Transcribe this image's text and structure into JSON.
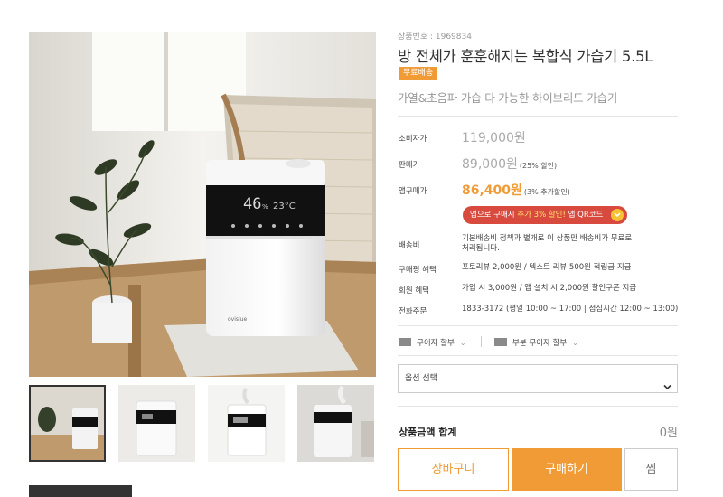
{
  "product": {
    "code": "상품번호 : 1969834",
    "title": "방 전체가 훈훈해지는 복합식 가습기 5.5L",
    "badge": "무료배송",
    "subtitle": "가열&초음파 가습 다 가능한 하이브리드 가습기",
    "device_display": {
      "humidity": "46",
      "unit": "%",
      "temp": "23°C",
      "brand": "ovislue"
    }
  },
  "prices": {
    "retail": {
      "label": "소비자가",
      "value": "119,000원"
    },
    "sale": {
      "label": "판매가",
      "value": "89,000원",
      "note": "(25% 할인)"
    },
    "app": {
      "label": "앱구매가",
      "value": "86,400원",
      "note": "(3% 추가할인)"
    }
  },
  "app_button": {
    "pre": "앱으로 구매시 ",
    "highlight": "추가 3% 할인!",
    "post": " 앱 QR코드"
  },
  "details": {
    "shipping": {
      "label": "배송비",
      "line1": "기본배송비 정책과 별개로 이 상품만 배송비가 무료로",
      "line2": "처리됩니다."
    },
    "review_benefit": {
      "label": "구매평 혜택",
      "text": "포토리뷰 2,000원 / 텍스트 리뷰 500원 적립금 지급"
    },
    "member_benefit": {
      "label": "회원 혜택",
      "text": "가입 시 3,000원 / 앱 설치 시 2,000원 할인쿠폰 지급"
    },
    "phone_order": {
      "label": "전화주문",
      "text": "1833-3172 (평일 10:00 ~ 17:00 | 점심시간 12:00 ~ 13:00)"
    }
  },
  "installments": [
    {
      "label": "무이자 할부"
    },
    {
      "label": "부분 무이자 할부"
    }
  ],
  "option_select": {
    "placeholder": "옵션 선택"
  },
  "total": {
    "label": "상품금액 합계",
    "value": "0원"
  },
  "buttons": {
    "cart": "장바구니",
    "buy": "구매하기",
    "wish": "찜"
  },
  "colors": {
    "accent": "#f19b36",
    "app_button": "#d8493e",
    "app_highlight": "#ffe36b"
  }
}
